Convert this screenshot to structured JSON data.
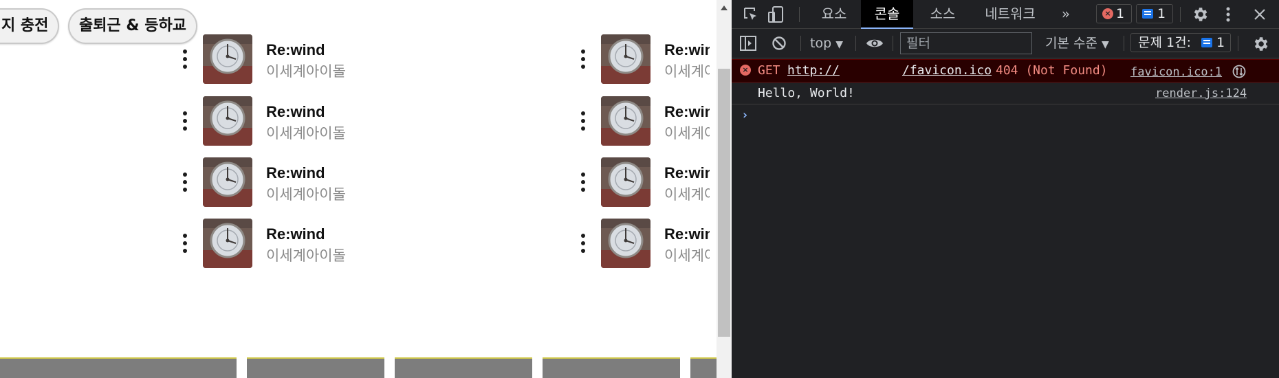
{
  "chips": [
    "지 충전",
    "출퇴근 & 등하교"
  ],
  "song_title": "Re:wind",
  "song_artist": "이세계아이돌",
  "devtools": {
    "tabs": [
      {
        "label": "요소",
        "active": false
      },
      {
        "label": "콘솔",
        "active": true
      },
      {
        "label": "소스",
        "active": false
      },
      {
        "label": "네트워크",
        "active": false
      }
    ],
    "more_tabs": "»",
    "error_count": "1",
    "message_count": "1",
    "context": "top",
    "filter_placeholder": "필터",
    "level": "기본 수준",
    "issues_label": "문제 1건:",
    "issues_count": "1",
    "console": {
      "error": {
        "method": "GET",
        "url_start": "http://",
        "url_end": "/favicon.ico",
        "status": "404 (Not Found)",
        "source": "favicon.ico:1"
      },
      "log": {
        "message": "Hello, World!",
        "source": "render.js:124"
      },
      "prompt": "›"
    }
  },
  "colors": {
    "devtools_bg": "#202124",
    "accent_blue": "#8ab4f8",
    "error_red": "#f28b82",
    "badge_blue": "#1a73e8"
  }
}
